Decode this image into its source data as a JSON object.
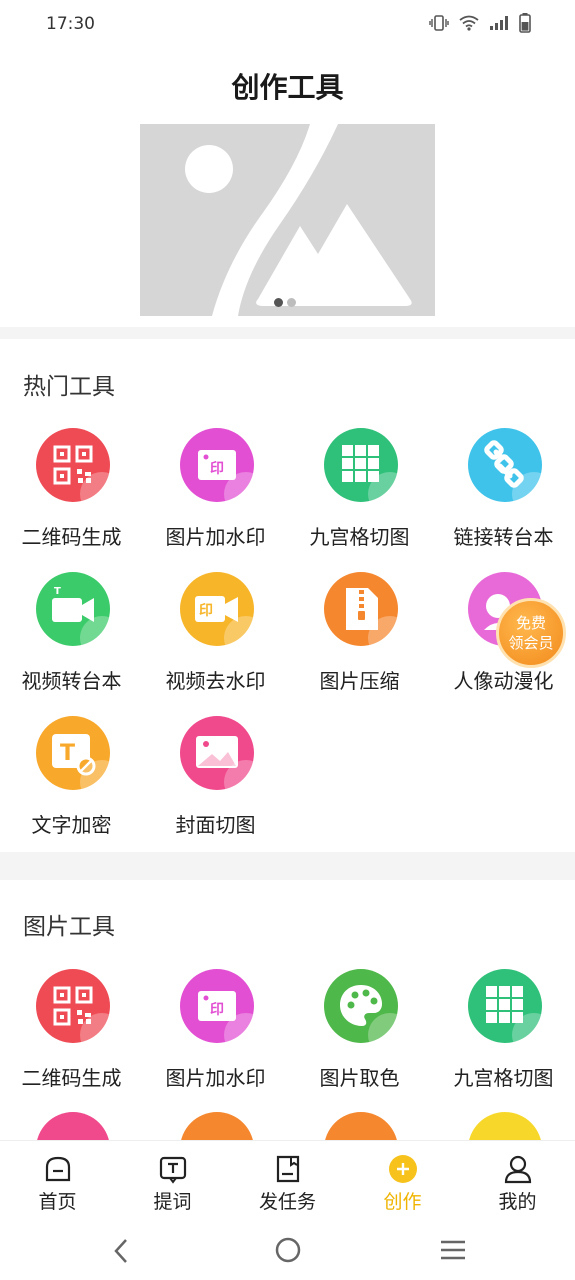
{
  "status_bar": {
    "time": "17:30",
    "icons": [
      "vibrate-icon",
      "wifi-icon",
      "signal-icon",
      "battery-icon"
    ]
  },
  "page": {
    "title": "创作工具"
  },
  "banner": {
    "image_icon": "image-placeholder-icon",
    "slides": 2,
    "active_slide": 1
  },
  "sections": [
    {
      "title": "热门工具",
      "tools": [
        {
          "label": "二维码生成",
          "icon": "qrcode-icon",
          "color": "#ef4b55"
        },
        {
          "label": "图片加水印",
          "icon": "watermark-icon",
          "color": "#e24fd3"
        },
        {
          "label": "九宫格切图",
          "icon": "grid-icon",
          "color": "#2fc07a"
        },
        {
          "label": "链接转台本",
          "icon": "link-icon",
          "color": "#3fc3ea"
        },
        {
          "label": "视频转台本",
          "icon": "video-icon",
          "color": "#3ccb6a"
        },
        {
          "label": "视频去水印",
          "icon": "video-watermark-icon",
          "color": "#f7b52a"
        },
        {
          "label": "图片压缩",
          "icon": "zip-icon",
          "color": "#f5872e"
        },
        {
          "label": "人像动漫化",
          "icon": "portrait-icon",
          "color": "#e86ad8"
        },
        {
          "label": "文字加密",
          "icon": "text-lock-icon",
          "color": "#f8a82a"
        },
        {
          "label": "封面切图",
          "icon": "cover-icon",
          "color": "#f04a8c"
        }
      ]
    },
    {
      "title": "图片工具",
      "tools": [
        {
          "label": "二维码生成",
          "icon": "qrcode-icon",
          "color": "#ef4b55"
        },
        {
          "label": "图片加水印",
          "icon": "watermark-icon",
          "color": "#e24fd3"
        },
        {
          "label": "图片取色",
          "icon": "palette-icon",
          "color": "#4fb84a"
        },
        {
          "label": "九宫格切图",
          "icon": "grid-icon",
          "color": "#2fc07a"
        }
      ]
    }
  ],
  "promo_badge": {
    "line1": "免费",
    "line2": "领会员",
    "color": "#f28a1c"
  },
  "bottom_nav": [
    {
      "label": "首页",
      "icon": "home-icon"
    },
    {
      "label": "提词",
      "icon": "prompter-icon"
    },
    {
      "label": "发任务",
      "icon": "task-icon"
    },
    {
      "label": "创作",
      "icon": "create-icon",
      "active": true
    },
    {
      "label": "我的",
      "icon": "profile-icon"
    }
  ],
  "accent_color": "#f0b400"
}
